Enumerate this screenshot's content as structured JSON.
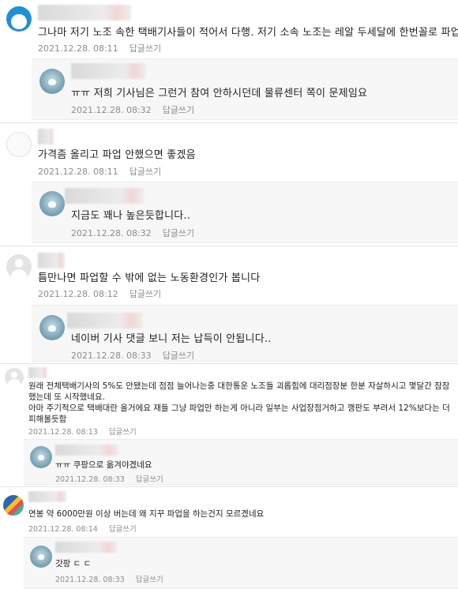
{
  "comments": [
    {
      "text": "그나마 저기 노조 속한 택배기사들이 적어서 다행. 저기 소속 노조는 레알 두세달에 한번꼴로 파업.",
      "date": "2021.12.28. 08:11",
      "reply_label": "답글쓰기",
      "avatar": "doraemon-avatar",
      "replies": [
        {
          "text": "ㅠㅠ 저희 기사님은 그런거 참여 안하시던데 물류센터 쪽이 문제임요",
          "date": "2021.12.28. 08:32",
          "reply_label": "답글쓰기"
        }
      ]
    },
    {
      "text": "가격좀 올리고 파업 안했으면 좋겠음",
      "date": "2021.12.28. 08:11",
      "reply_label": "답글쓰기",
      "avatar": "sketch-avatar",
      "replies": [
        {
          "text": "지금도 꽤나 높은듯합니다..",
          "date": "2021.12.28. 08:32",
          "reply_label": "답글쓰기"
        }
      ]
    },
    {
      "text": "틈만나면 파업할 수 밖에 없는 노동환경인가 봅니다",
      "date": "2021.12.28. 08:12",
      "reply_label": "답글쓰기",
      "avatar": "default-avatar",
      "replies": [
        {
          "text": "네이버 기사 댓글 보니 저는 납득이 안됩니다..",
          "date": "2021.12.28. 08:33",
          "reply_label": "답글쓰기"
        }
      ]
    },
    {
      "text": "원래 전체택배기사의 5%도 안됐는데 점점 늘어나는중 대한통운 노조들 괴롭힘에 대리점장분 한분 자살하시고 몇달간 잠잠했는데 또 시작했네요.\n아마 주기적으로 택배대란 올거에요 재들 그냥 파업만 하는게 아니라 일부는 사업장점거하고 깽판도 부려서 12%보다는 더 피해볼듯함",
      "date": "2021.12.28. 08:13",
      "reply_label": "답글쓰기",
      "avatar": "default-avatar",
      "replies": [
        {
          "text": "ㅠㅠ 쿠팡으로 옮겨야겠네요",
          "date": "2021.12.28. 08:33",
          "reply_label": "답글쓰기"
        }
      ]
    },
    {
      "text": "연봉 약 6000만원 이상 버는데 왜 지꾸 파업을 하는건지 모르겠네요",
      "date": "2021.12.28. 08:14",
      "reply_label": "답글쓰기",
      "avatar": "colorful-avatar",
      "replies": [
        {
          "text": "갓팡 ㄷ ㄷ",
          "date": "2021.12.28. 08:33",
          "reply_label": "답글쓰기"
        }
      ]
    }
  ]
}
